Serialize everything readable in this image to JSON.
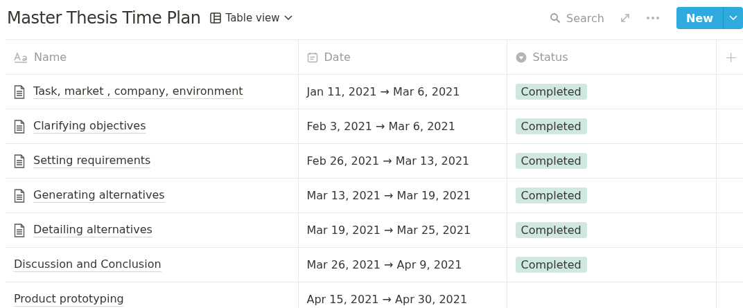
{
  "title": "Master Thesis Time Plan",
  "view": {
    "label": "Table view"
  },
  "toolbar": {
    "search": "Search",
    "new_button": "New"
  },
  "columns": [
    {
      "kind": "title",
      "label": "Name"
    },
    {
      "kind": "date",
      "label": "Date"
    },
    {
      "kind": "select",
      "label": "Status"
    }
  ],
  "add_column": "+",
  "rows": [
    {
      "kind": "page",
      "name": "Task, market , company, environment",
      "date": "Jan 11, 2021 → Mar 6, 2021",
      "status": "Completed"
    },
    {
      "kind": "page",
      "name": "Clarifying objectives",
      "date": "Feb 3, 2021 → Mar 6, 2021",
      "status": "Completed"
    },
    {
      "kind": "page",
      "name": "Setting requirements",
      "date": "Feb 26, 2021 → Mar 13, 2021",
      "status": "Completed"
    },
    {
      "kind": "page",
      "name": "Generating alternatives",
      "date": "Mar 13, 2021 → Mar 19, 2021",
      "status": "Completed"
    },
    {
      "kind": "page",
      "name": "Detailing alternatives",
      "date": "Mar 19, 2021 → Mar 25, 2021",
      "status": "Completed"
    },
    {
      "kind": "plain",
      "name": "Discussion and Conclusion",
      "date": "Mar 26, 2021 → Apr 9, 2021",
      "status": "Completed"
    },
    {
      "kind": "plain",
      "name": "Product prototyping",
      "date": "Apr 15, 2021 → Apr 30, 2021"
    }
  ]
}
